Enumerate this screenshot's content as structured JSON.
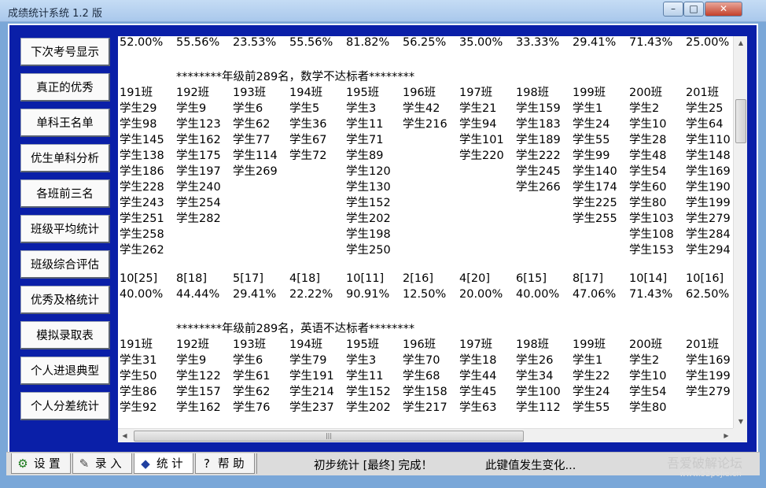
{
  "window": {
    "title": "成绩统计系统 1.2 版"
  },
  "sidebar": {
    "buttons": [
      {
        "label": "下次考号显示"
      },
      {
        "label": "真正的优秀"
      },
      {
        "label": "单科王名单"
      },
      {
        "label": "优生单科分析"
      },
      {
        "label": "各班前三名"
      },
      {
        "label": "班级平均统计"
      },
      {
        "label": "班级综合评估"
      },
      {
        "label": "优秀及格统计"
      },
      {
        "label": "模拟录取表"
      },
      {
        "label": "个人进退典型"
      },
      {
        "label": "个人分差统计"
      }
    ]
  },
  "report": {
    "top_percentages": [
      "52.00%",
      "55.56%",
      "23.53%",
      "55.56%",
      "81.82%",
      "56.25%",
      "35.00%",
      "33.33%",
      "29.41%",
      "71.43%",
      "25.00%"
    ],
    "math_section": {
      "heading": "********年级前289名，数学不达标者********",
      "classes": [
        "191班",
        "192班",
        "193班",
        "194班",
        "195班",
        "196班",
        "197班",
        "198班",
        "199班",
        "200班",
        "201班"
      ],
      "columns": [
        [
          "学生29",
          "学生98",
          "学生145",
          "学生138",
          "学生186",
          "学生228",
          "学生243",
          "学生251",
          "学生258",
          "学生262"
        ],
        [
          "学生9",
          "学生123",
          "学生162",
          "学生175",
          "学生197",
          "学生240",
          "学生254",
          "学生282"
        ],
        [
          "学生6",
          "学生62",
          "学生77",
          "学生114",
          "学生269"
        ],
        [
          "学生5",
          "学生36",
          "学生67",
          "学生72"
        ],
        [
          "学生3",
          "学生11",
          "学生71",
          "学生89",
          "学生120",
          "学生130",
          "学生152",
          "学生202",
          "学生198",
          "学生250"
        ],
        [
          "学生42",
          "学生216"
        ],
        [
          "学生21",
          "学生94",
          "学生101",
          "学生220"
        ],
        [
          "学生159",
          "学生183",
          "学生189",
          "学生222",
          "学生245",
          "学生266"
        ],
        [
          "学生1",
          "学生24",
          "学生55",
          "学生99",
          "学生140",
          "学生174",
          "学生225",
          "学生255"
        ],
        [
          "学生2",
          "学生10",
          "学生28",
          "学生48",
          "学生54",
          "学生60",
          "学生80",
          "学生103",
          "学生108",
          "学生153"
        ],
        [
          "学生25",
          "学生64",
          "学生110",
          "学生148",
          "学生169",
          "学生190",
          "学生199",
          "学生279",
          "学生284",
          "学生294"
        ]
      ],
      "counts": [
        "10[25]",
        "8[18]",
        "5[17]",
        "4[18]",
        "10[11]",
        "2[16]",
        "4[20]",
        "6[15]",
        "8[17]",
        "10[14]",
        "10[16]"
      ],
      "percentages": [
        "40.00%",
        "44.44%",
        "29.41%",
        "22.22%",
        "90.91%",
        "12.50%",
        "20.00%",
        "40.00%",
        "47.06%",
        "71.43%",
        "62.50%"
      ]
    },
    "english_section": {
      "heading": "********年级前289名，英语不达标者********",
      "classes": [
        "191班",
        "192班",
        "193班",
        "194班",
        "195班",
        "196班",
        "197班",
        "198班",
        "199班",
        "200班",
        "201班"
      ],
      "columns": [
        [
          "学生31",
          "学生50",
          "学生86",
          "学生92"
        ],
        [
          "学生9",
          "学生122",
          "学生157",
          "学生162"
        ],
        [
          "学生6",
          "学生61",
          "学生62",
          "学生76"
        ],
        [
          "学生79",
          "学生191",
          "学生214",
          "学生237"
        ],
        [
          "学生3",
          "学生11",
          "学生152",
          "学生202"
        ],
        [
          "学生70",
          "学生68",
          "学生158",
          "学生217"
        ],
        [
          "学生18",
          "学生44",
          "学生45",
          "学生63"
        ],
        [
          "学生26",
          "学生34",
          "学生100",
          "学生112"
        ],
        [
          "学生1",
          "学生22",
          "学生24",
          "学生55"
        ],
        [
          "学生2",
          "学生10",
          "学生54",
          "学生80"
        ],
        [
          "学生169",
          "学生199",
          "学生279"
        ]
      ]
    }
  },
  "statusbar": {
    "tabs": [
      {
        "label": "设 置",
        "icon": "settings-icon"
      },
      {
        "label": "录 入",
        "icon": "pen-icon"
      },
      {
        "label": "统 计",
        "icon": "stats-icon"
      },
      {
        "label": "帮 助",
        "icon": "help-icon"
      }
    ],
    "message": "初步统计 [最终] 完成！",
    "key_message": "此键值发生变化...",
    "watermark": "吾爱破解论坛",
    "watermark_url": "www.52pojie.cn"
  }
}
